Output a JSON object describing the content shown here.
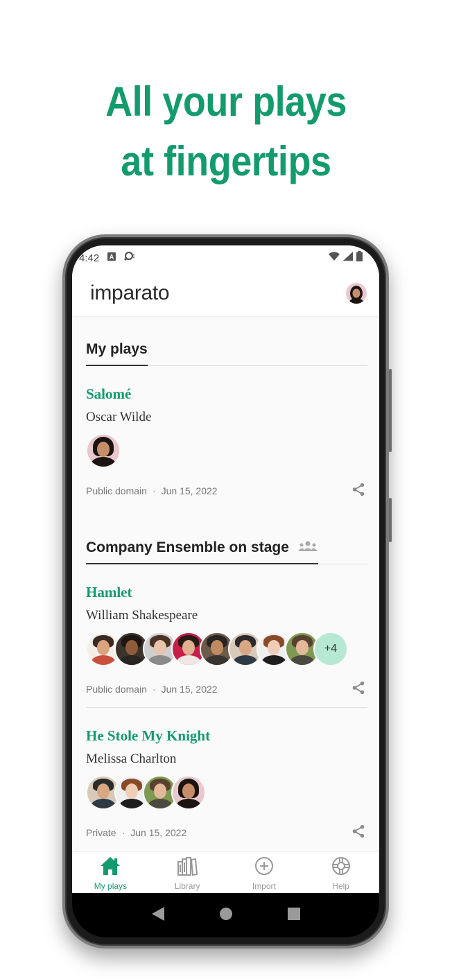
{
  "headline": {
    "line1": "All your plays",
    "line2": "at fingertips"
  },
  "colors": {
    "accent": "#139b6c",
    "more_badge": "#b6e8d3"
  },
  "status_bar": {
    "time": "4:42",
    "left_icons": [
      "keyboard-a-icon",
      "sync-icon"
    ],
    "right_icons": [
      "wifi-icon",
      "signal-icon",
      "battery-icon"
    ]
  },
  "app_bar": {
    "logo": "imparato",
    "avatar": "user-avatar"
  },
  "sections": [
    {
      "title": "My plays",
      "plays": [
        {
          "title": "Salomé",
          "author": "Oscar Wilde",
          "avatars": 1,
          "extra": "",
          "license": "Public domain",
          "date": "Jun 15, 2022"
        }
      ]
    },
    {
      "title": "Company Ensemble on stage",
      "icon": "group-icon",
      "plays": [
        {
          "title": "Hamlet",
          "author": "William Shakespeare",
          "avatars": 8,
          "extra": "+4",
          "license": "Public domain",
          "date": "Jun 15, 2022"
        },
        {
          "title": "He Stole My Knight",
          "author": "Melissa Charlton",
          "avatars": 4,
          "extra": "",
          "license": "Private",
          "date": "Jun 15, 2022"
        }
      ]
    }
  ],
  "meta_separator": "·",
  "bottom_nav": [
    {
      "label": "My plays",
      "icon": "home-icon",
      "active": true
    },
    {
      "label": "Library",
      "icon": "library-icon",
      "active": false
    },
    {
      "label": "Import",
      "icon": "add-circle-icon",
      "active": false
    },
    {
      "label": "Help",
      "icon": "lifebuoy-icon",
      "active": false
    }
  ],
  "system_nav": [
    "back-button",
    "home-button",
    "recents-button"
  ]
}
